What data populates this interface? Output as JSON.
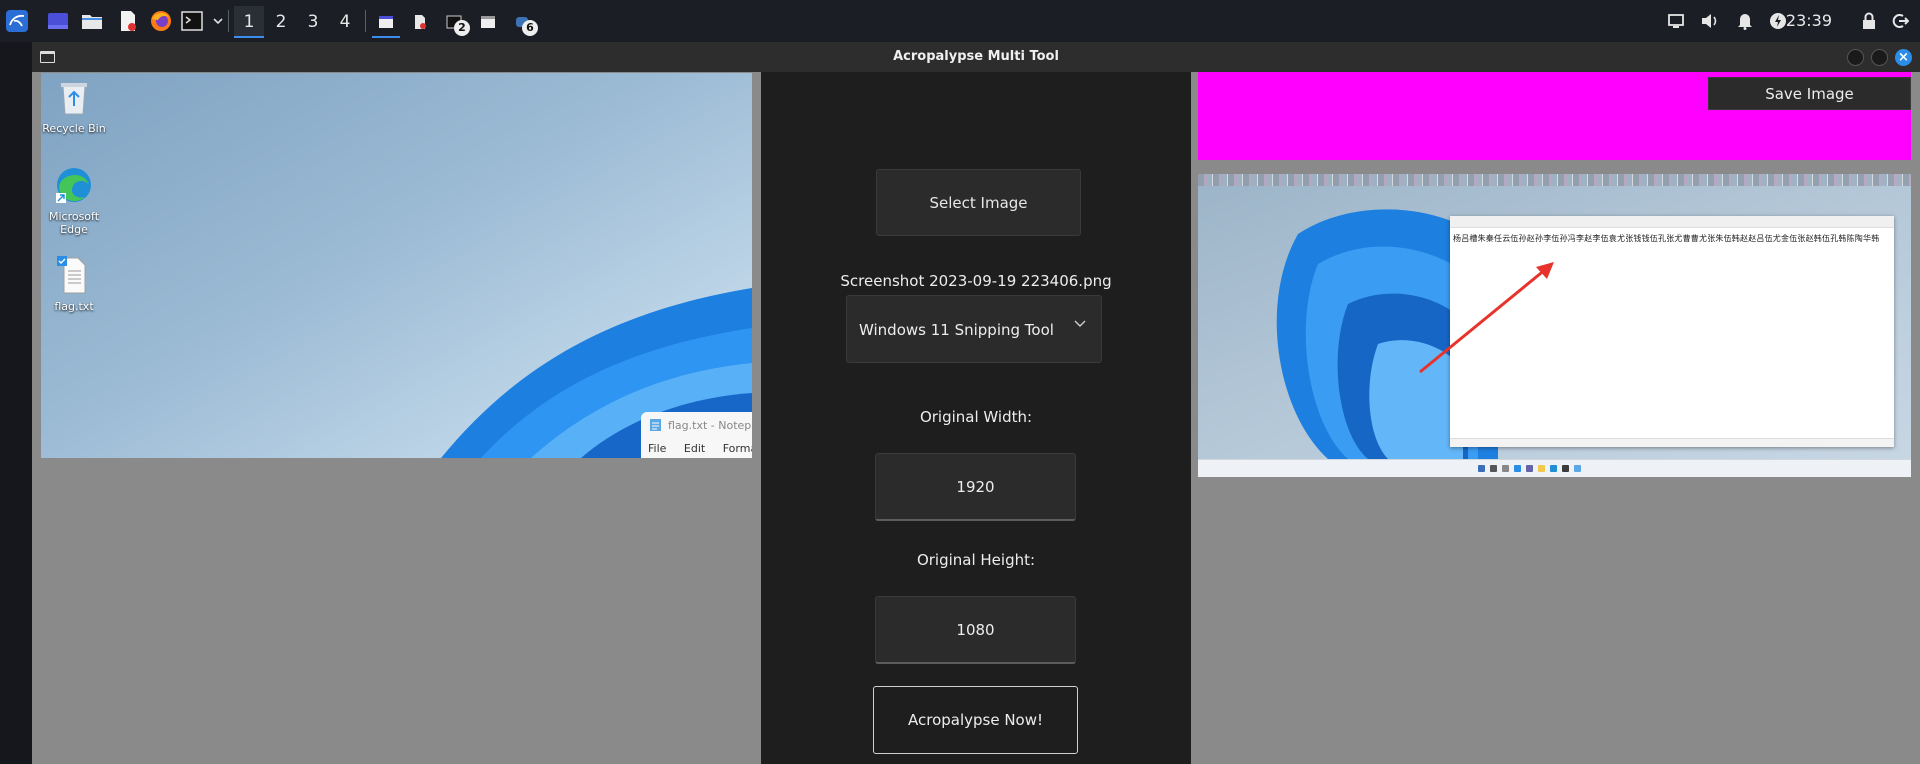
{
  "taskbar": {
    "workspaces": [
      "1",
      "2",
      "3",
      "4"
    ],
    "active_workspace": "1",
    "badges": [
      "2",
      "6"
    ],
    "clock": "23:39",
    "icons": [
      "kali-menu-icon",
      "show-desktop-icon",
      "file-manager-icon",
      "text-editor-icon",
      "firefox-icon",
      "terminal-icon",
      "chevron-down-icon",
      "volume-icon",
      "notification-bell-icon",
      "power-manager-icon",
      "lock-icon",
      "logout-icon",
      "display-icon"
    ]
  },
  "window": {
    "title": "Acropalypse Multi Tool",
    "close_glyph": "×"
  },
  "left_preview": {
    "desktop_icons": [
      {
        "label": "Recycle Bin",
        "icon": "recycle-bin-icon"
      },
      {
        "label": "Microsoft Edge",
        "icon": "edge-icon"
      },
      {
        "label": "flag.txt",
        "icon": "text-file-icon"
      }
    ],
    "notepad_title": "flag.txt - Notepad",
    "notepad_menu": [
      "File",
      "Edit",
      "Format"
    ]
  },
  "controls": {
    "select_image_label": "Select Image",
    "filename": "Screenshot 2023-09-19 223406.png",
    "tool_selected": "Windows 11 Snipping Tool",
    "original_width_label": "Original Width:",
    "original_width_value": "1920",
    "original_height_label": "Original Height:",
    "original_height_value": "1080",
    "run_label": "Acropalypse Now!"
  },
  "output": {
    "save_label": "Save Image",
    "recovered_text": "杨吕槽朱秦任云伍孙赵孙李伍孙冯李赵李伍袁尤张钱钱伍孔张尤曹曹尤张朱伍韩赵赵吕伍尤金伍张赵韩伍孔韩陈陶华韩",
    "magenta_color": "#ff00ff"
  },
  "colors": {
    "accent": "#3d8cf0",
    "window_bg": "#1e1e1e",
    "pane_bg": "#8a8a8a"
  }
}
